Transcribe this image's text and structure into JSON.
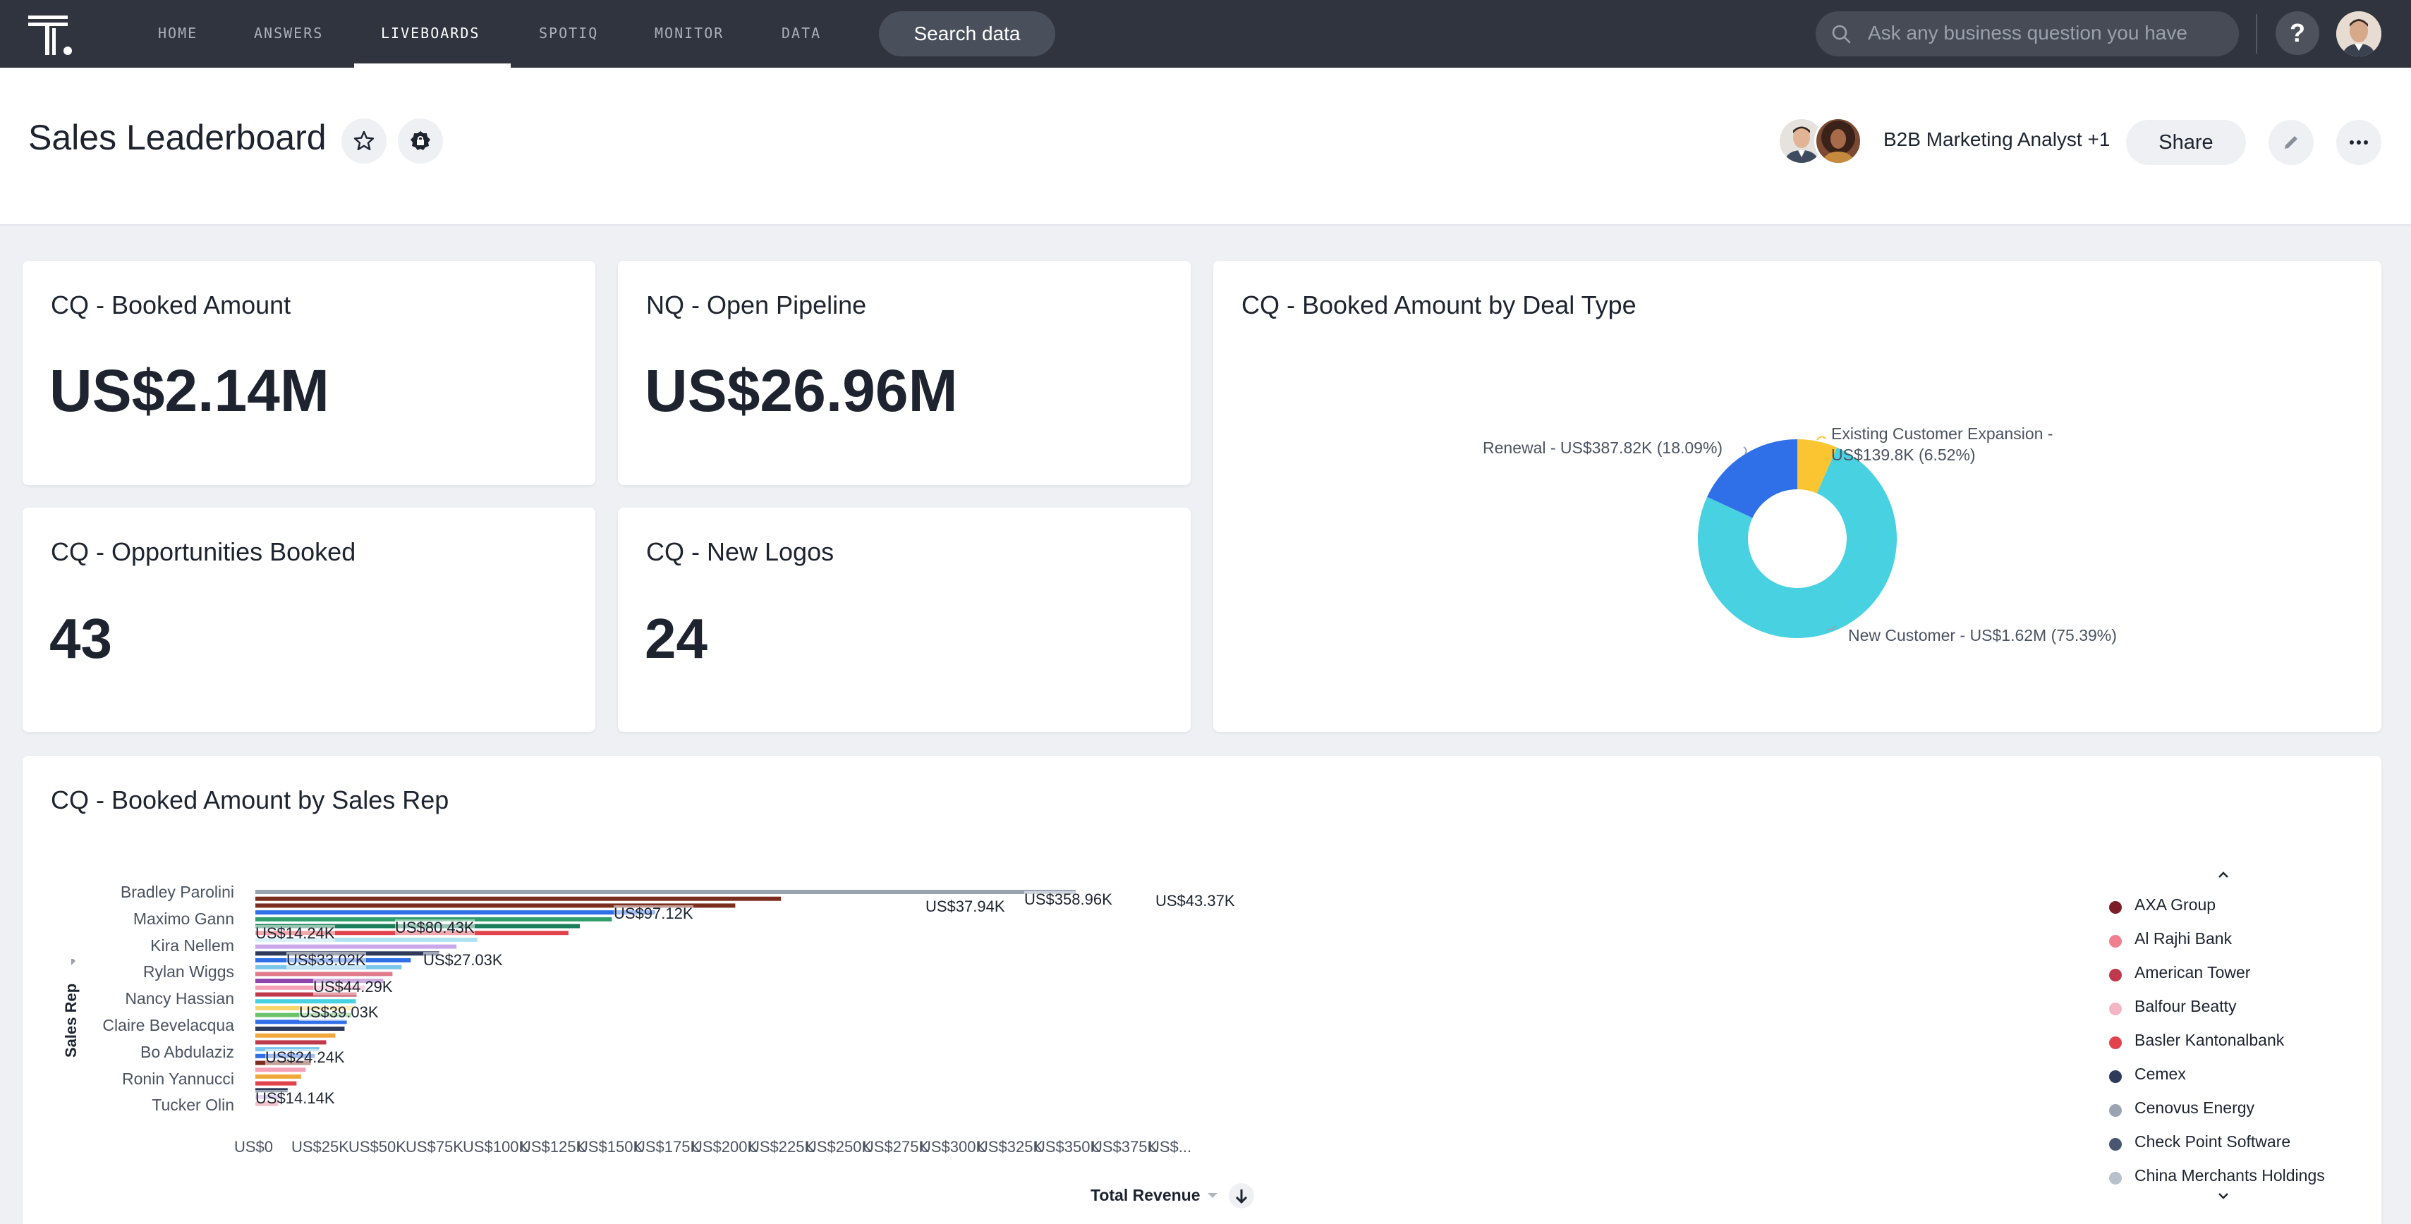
{
  "nav": {
    "items": [
      "HOME",
      "ANSWERS",
      "LIVEBOARDS",
      "SPOTIQ",
      "MONITOR",
      "DATA"
    ],
    "active": "LIVEBOARDS",
    "search_button": "Search data",
    "ask_placeholder": "Ask any business question you have",
    "help_label": "?"
  },
  "header": {
    "title": "Sales Leaderboard",
    "shared_with": "B2B Marketing Analyst +1",
    "share_label": "Share"
  },
  "kpis": [
    {
      "title": "CQ - Booked Amount",
      "value": "US$2.14M"
    },
    {
      "title": "NQ - Open Pipeline",
      "value": "US$26.96M"
    },
    {
      "title": "CQ - Opportunities Booked",
      "value": "43"
    },
    {
      "title": "CQ - New Logos",
      "value": "24"
    }
  ],
  "donut_chart": {
    "title": "CQ - Booked Amount by Deal Type",
    "labels": {
      "renewal": "Renewal - US$387.82K (18.09%)",
      "expansion_line1": "Existing Customer Expansion -",
      "expansion_line2": "US$139.8K (6.52%)",
      "new_customer": "New Customer - US$1.62M (75.39%)"
    }
  },
  "bar_chart": {
    "title": "CQ - Booked Amount by Sales Rep",
    "y_axis_label": "Sales Rep",
    "x_axis_label": "Total Revenue",
    "legend": [
      "AXA Group",
      "Al Rajhi Bank",
      "American Tower",
      "Balfour Beatty",
      "Basler Kantonalbank",
      "Cemex",
      "Cenovus Energy",
      "Check Point Software",
      "China Merchants Holdings"
    ],
    "x_ticks": [
      "US$0",
      "US$25K",
      "US$50K",
      "US$75K",
      "US$100K",
      "US$125K",
      "US$150K",
      "US$175K",
      "US$200K",
      "US$225K",
      "US$250K",
      "US$275K",
      "US$300K",
      "US$325K",
      "US$350K",
      "US$375K",
      "US$..."
    ],
    "data_labels": [
      "US$97.12K",
      "US$37.94K",
      "US$358.96K",
      "US$43.37K",
      "US$14.24K",
      "US$80.43K",
      "US$33.02K",
      "US$27.03K",
      "US$44.29K",
      "US$39.03K",
      "US$24.24K",
      "US$14.14K"
    ]
  },
  "chart_data": [
    {
      "type": "pie",
      "title": "CQ - Booked Amount by Deal Type",
      "donut": true,
      "slices": [
        {
          "name": "New Customer",
          "value": 1620,
          "percent": 75.39,
          "color": "#48d1e0"
        },
        {
          "name": "Renewal",
          "value": 387.82,
          "percent": 18.09,
          "color": "#2f6fe8"
        },
        {
          "name": "Existing Customer Expansion",
          "value": 139.8,
          "percent": 6.52,
          "color": "#fbc531"
        }
      ],
      "unit": "US$K"
    },
    {
      "type": "bar",
      "orientation": "horizontal",
      "title": "CQ - Booked Amount by Sales Rep",
      "xlabel": "Total Revenue",
      "ylabel": "Sales Rep",
      "xlim": [
        0,
        380000
      ],
      "categories": [
        "Bradley Parolini",
        "Maximo Gann",
        "Kira Nellem",
        "Rylan Wiggs",
        "Nancy Hassian",
        "Claire Bevelacqua",
        "Bo Abdulaziz",
        "Ronin Yannucci",
        "Tucker Olin"
      ],
      "label_categories": [
        "Bradley Parolini",
        "Maximo Gann",
        "Kira Nellem",
        "Rylan Wiggs",
        "Nancy Hassian",
        "Claire Bevelacqua",
        "Bo Abdulaziz",
        "Ronin Yannucci",
        "Tucker Olin"
      ],
      "bars": [
        {
          "value": 358960,
          "color": "#9aa3b2"
        },
        {
          "value": 230000,
          "color": "#7b2e1e"
        },
        {
          "value": 210000,
          "color": "#7b2e1e"
        },
        {
          "value": 175000,
          "color": "#2f6fe8"
        },
        {
          "value": 156000,
          "color": "#2f9e6a"
        },
        {
          "value": 142000,
          "color": "#1a7f5a"
        },
        {
          "value": 137000,
          "color": "#e2424c"
        },
        {
          "value": 97120,
          "color": "#aee2f0"
        },
        {
          "value": 88000,
          "color": "#c9a7e8"
        },
        {
          "value": 80430,
          "color": "#2e3a59"
        },
        {
          "value": 68000,
          "color": "#2f6fe8"
        },
        {
          "value": 64000,
          "color": "#7ac5ea"
        },
        {
          "value": 60000,
          "color": "#e07a8a"
        },
        {
          "value": 56000,
          "color": "#8e44ad"
        },
        {
          "value": 48000,
          "color": "#f4a0b5"
        },
        {
          "value": 44290,
          "color": "#c0384b"
        },
        {
          "value": 44000,
          "color": "#48d1e0"
        },
        {
          "value": 43000,
          "color": "#f9d56e"
        },
        {
          "value": 42000,
          "color": "#6bc26b"
        },
        {
          "value": 40000,
          "color": "#2f6fe8"
        },
        {
          "value": 39030,
          "color": "#2e3a59"
        },
        {
          "value": 35000,
          "color": "#f0a83a"
        },
        {
          "value": 31000,
          "color": "#c0384b"
        },
        {
          "value": 28000,
          "color": "#7ac5ea"
        },
        {
          "value": 26000,
          "color": "#2f6fe8"
        },
        {
          "value": 24240,
          "color": "#7b2e1e"
        },
        {
          "value": 22000,
          "color": "#f4a0b5"
        },
        {
          "value": 20000,
          "color": "#f0a83a"
        },
        {
          "value": 18000,
          "color": "#e2424c"
        },
        {
          "value": 14140,
          "color": "#2e3a59"
        },
        {
          "value": 11000,
          "color": "#c9a7e8"
        },
        {
          "value": 10000,
          "color": "#e07a8a"
        }
      ]
    }
  ],
  "colors": {
    "nav_bg": "#2f343f",
    "legend": [
      "#7b1e2a",
      "#f08090",
      "#c0384b",
      "#f4b6c2",
      "#e2424c",
      "#2e3a59",
      "#9aa3b2",
      "#4a5570",
      "#b8c0cc"
    ]
  }
}
